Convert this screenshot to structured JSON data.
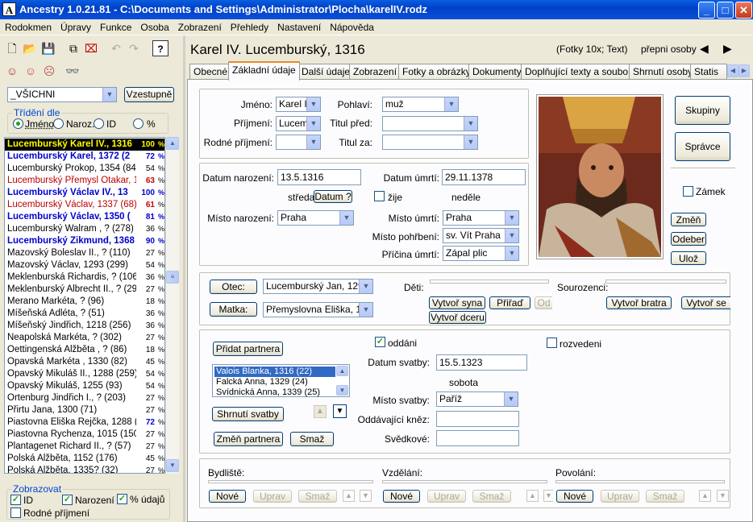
{
  "window": {
    "title": "Ancestry 1.0.21.81 - C:\\Documents and Settings\\Administrator\\Plocha\\karelIV.rodz",
    "icon": "A"
  },
  "menu": [
    "Rodokmen",
    "Úpravy",
    "Funkce",
    "Osoba",
    "Zobrazení",
    "Přehledy",
    "Nastavení",
    "Nápověda"
  ],
  "sidebar": {
    "filter_value": "_VŠICHNI",
    "sort_button": "Vzestupně",
    "sort_group_title": "Třídění dle",
    "sort_options": [
      "Jméno",
      "Naroz.",
      "ID",
      "%"
    ],
    "persons": [
      {
        "name": "Lucemburský Karel IV., 1316",
        "pct": "100",
        "style": "selected"
      },
      {
        "name": "Lucemburský Karel, 1372 (2",
        "pct": "72",
        "style": "bold-blue"
      },
      {
        "name": "Lucemburský Prokop, 1354 (84)",
        "pct": "54",
        "style": "normal"
      },
      {
        "name": "Lucemburský Přemysl Otakar, 131",
        "pct": "63",
        "style": "red"
      },
      {
        "name": "Lucemburský Václav IV., 13",
        "pct": "100",
        "style": "bold-blue"
      },
      {
        "name": "Lucemburský Václav, 1337 (68)",
        "pct": "61",
        "style": "red"
      },
      {
        "name": "Lucemburský Václav, 1350 (",
        "pct": "81",
        "style": "bold-blue"
      },
      {
        "name": "Lucemburský Walram , ? (278)",
        "pct": "36",
        "style": "normal"
      },
      {
        "name": "Lucemburský Zikmund, 1368",
        "pct": "90",
        "style": "bold-blue"
      },
      {
        "name": "Mazovský Boleslav II., ? (110)",
        "pct": "27",
        "style": "normal"
      },
      {
        "name": "Mazovský Václav, 1293 (299)",
        "pct": "54",
        "style": "normal"
      },
      {
        "name": "Meklenburská Richardis, ? (106)",
        "pct": "36",
        "style": "normal"
      },
      {
        "name": "Meklenburský Albrecht II., ? (293)",
        "pct": "27",
        "style": "normal"
      },
      {
        "name": "Merano Markéta, ? (96)",
        "pct": "18",
        "style": "normal"
      },
      {
        "name": "Míšeňská Adléta, ? (51)",
        "pct": "36",
        "style": "normal"
      },
      {
        "name": "Míšeňský Jindřich, 1218 (256)",
        "pct": "36",
        "style": "normal"
      },
      {
        "name": "Neapolská Markéta, ? (302)",
        "pct": "27",
        "style": "normal"
      },
      {
        "name": "Oettingenská Alžběta , ? (86)",
        "pct": "18",
        "style": "normal"
      },
      {
        "name": "Opavská Markéta , 1330 (82)",
        "pct": "45",
        "style": "normal"
      },
      {
        "name": "Opavský Mikuláš II., 1288 (259)",
        "pct": "54",
        "style": "normal"
      },
      {
        "name": "Opavský Mikuláš, 1255 (93)",
        "pct": "54",
        "style": "normal"
      },
      {
        "name": "Ortenburg Jindřich I., ? (203)",
        "pct": "27",
        "style": "normal"
      },
      {
        "name": "Přirtu Jana, 1300 (71)",
        "pct": "27",
        "style": "normal"
      },
      {
        "name": "Piastovna Eliška Rejčka, 1288 (3",
        "pct": "72",
        "style": "normal"
      },
      {
        "name": "Piastovna Rychenza, 1015 (150)",
        "pct": "27",
        "style": "normal"
      },
      {
        "name": "Plantagenet Richard II., ? (57)",
        "pct": "27",
        "style": "normal"
      },
      {
        "name": "Polská Alžběta, 1152 (176)",
        "pct": "45",
        "style": "normal"
      },
      {
        "name": "Polská Alžběta, 1335? (32)",
        "pct": "27",
        "style": "normal"
      }
    ],
    "percent_sign": "%",
    "display_group_title": "Zobrazovat",
    "display_options": [
      {
        "label": "ID",
        "checked": true
      },
      {
        "label": "Narození",
        "checked": true
      },
      {
        "label": "% údajů",
        "checked": true
      },
      {
        "label": "Rodné příjmení",
        "checked": false
      }
    ]
  },
  "header": {
    "person_title": "Karel IV. Lucemburský, 1316",
    "photos_info": "(Fotky 10x; Text)",
    "switch_label": "přepni osoby"
  },
  "tabs": [
    "Obecné",
    "Základní údaje",
    "Další údaje",
    "Zobrazení",
    "Fotky a obrázky",
    "Dokumenty",
    "Doplňující texty a soubory",
    "Shrnutí osoby",
    "Statis"
  ],
  "selected_tab": 1,
  "basic": {
    "name_label": "Jméno:",
    "name_value": "Karel I",
    "surname_label": "Příjmení:",
    "surname_value": "Lucem",
    "birth_surname_label": "Rodné příjmení:",
    "birth_surname_value": "",
    "sex_label": "Pohlaví:",
    "sex_value": "muž",
    "title_before_label": "Titul před:",
    "title_before_value": "",
    "title_after_label": "Titul za:",
    "title_after_value": ""
  },
  "dates": {
    "birth_date_label": "Datum narození:",
    "birth_date": "13.5.1316",
    "birth_weekday": "středa",
    "date_button": "Datum ?",
    "death_date_label": "Datum úmrtí:",
    "death_date": "29.11.1378",
    "alive_label": "žije",
    "alive_checked": false,
    "death_weekday": "neděle",
    "birth_place_label": "Místo narození:",
    "birth_place": "Praha",
    "death_place_label": "Místo úmrtí:",
    "death_place": "Praha",
    "burial_place_label": "Místo pohřbení:",
    "burial_place": "sv. Vít Praha",
    "death_cause_label": "Příčina úmrtí:",
    "death_cause": "Zápal plic"
  },
  "right_buttons": {
    "groups": "Skupiny",
    "admin": "Správce",
    "lock_label": "Zámek",
    "lock_checked": false,
    "change": "Změň",
    "remove": "Odeber",
    "save": "Ulož"
  },
  "parents": {
    "father_button": "Otec:",
    "father_value": "Lucemburský Jan, 1296",
    "mother_button": "Matka:",
    "mother_value": "Přemyslovna Eliška, 129",
    "children_label": "Děti:",
    "siblings_label": "Sourozenci:",
    "create_son": "Vytvoř syna",
    "assign": "Přiřaď",
    "od": "Od",
    "create_daughter": "Vytvoř dceru",
    "create_brother": "Vytvoř bratra",
    "create_sister": "Vytvoř se"
  },
  "marriage": {
    "add_partner": "Přidat partnera",
    "partners": [
      "Valois Blanka, 1316 (22)",
      "Falcká Anna, 1329 (24)",
      "Svídnická Anna, 1339 (25)"
    ],
    "selected_partner": 0,
    "summary_button": "Shrnutí svatby",
    "change_partner": "Změň partnera",
    "delete": "Smaž",
    "married_label": "oddáni",
    "married_checked": true,
    "divorced_label": "rozvedeni",
    "divorced_checked": false,
    "wedding_date_label": "Datum svatby:",
    "wedding_date": "15.5.1323",
    "wedding_weekday": "sobota",
    "wedding_place_label": "Místo svatby:",
    "wedding_place": "Paříž",
    "priest_label": "Oddávající kněz:",
    "priest": "",
    "witnesses_label": "Svědkové:",
    "witnesses": ""
  },
  "bottom": {
    "residence_label": "Bydliště:",
    "education_label": "Vzdělání:",
    "occupation_label": "Povolání:",
    "new": "Nové",
    "edit": "Uprav",
    "delete": "Smaž"
  },
  "colors": {
    "selected_bg": "#000000",
    "selected_fg": "#ffff00",
    "bold_blue": "#0000cc",
    "red": "#bb0000",
    "percent_blue": "#0000cc",
    "percent_red": "#cc0000"
  }
}
